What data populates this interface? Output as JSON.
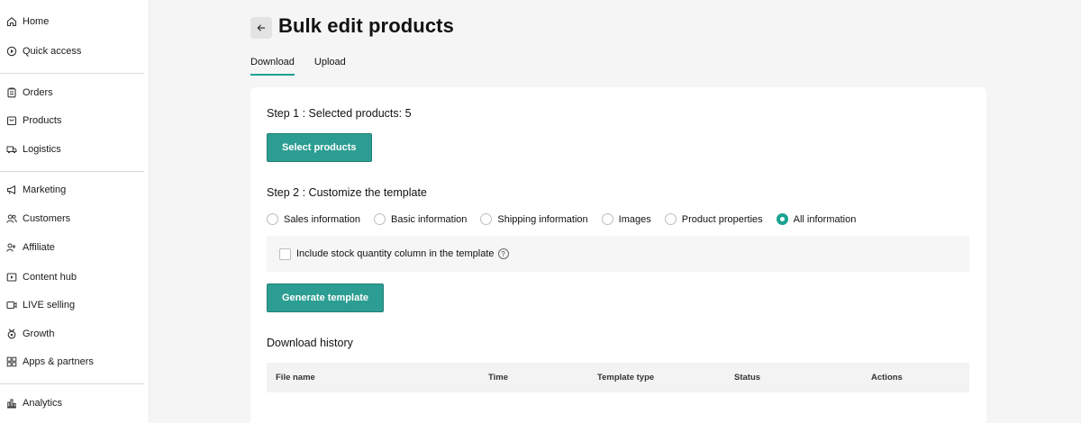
{
  "sidebar": {
    "items": [
      {
        "label": "Home",
        "icon": "home-icon"
      },
      {
        "label": "Quick access",
        "icon": "quick-access-icon"
      },
      {
        "label": "Orders",
        "icon": "orders-icon"
      },
      {
        "label": "Products",
        "icon": "products-icon"
      },
      {
        "label": "Logistics",
        "icon": "truck-icon"
      },
      {
        "label": "Marketing",
        "icon": "megaphone-icon"
      },
      {
        "label": "Customers",
        "icon": "customers-icon"
      },
      {
        "label": "Affiliate",
        "icon": "affiliate-icon"
      },
      {
        "label": "Content hub",
        "icon": "content-hub-icon"
      },
      {
        "label": "LIVE selling",
        "icon": "live-icon"
      },
      {
        "label": "Growth",
        "icon": "growth-icon"
      },
      {
        "label": "Apps & partners",
        "icon": "apps-icon"
      },
      {
        "label": "Analytics",
        "icon": "analytics-icon"
      }
    ]
  },
  "page": {
    "title": "Bulk edit products",
    "back_icon": "arrow-left-icon"
  },
  "tabs": [
    {
      "label": "Download",
      "active": true
    },
    {
      "label": "Upload",
      "active": false
    }
  ],
  "step1": {
    "title": "Step 1 :  Selected products: 5",
    "button_label": "Select products"
  },
  "step2": {
    "title": "Step 2 :  Customize the template",
    "options": [
      {
        "label": "Sales information",
        "checked": false
      },
      {
        "label": "Basic information",
        "checked": false
      },
      {
        "label": "Shipping information",
        "checked": false
      },
      {
        "label": "Images",
        "checked": false
      },
      {
        "label": "Product properties",
        "checked": false
      },
      {
        "label": "All information",
        "checked": true
      }
    ],
    "checkbox_label": "Include stock quantity column in the template",
    "checkbox_checked": false,
    "help_icon": "question-circle-icon",
    "generate_label": "Generate template"
  },
  "history": {
    "title": "Download history",
    "columns": [
      "File name",
      "Time",
      "Template type",
      "Status",
      "Actions"
    ]
  },
  "colors": {
    "accent": "#2c9d92",
    "background": "#f5f5f5"
  }
}
